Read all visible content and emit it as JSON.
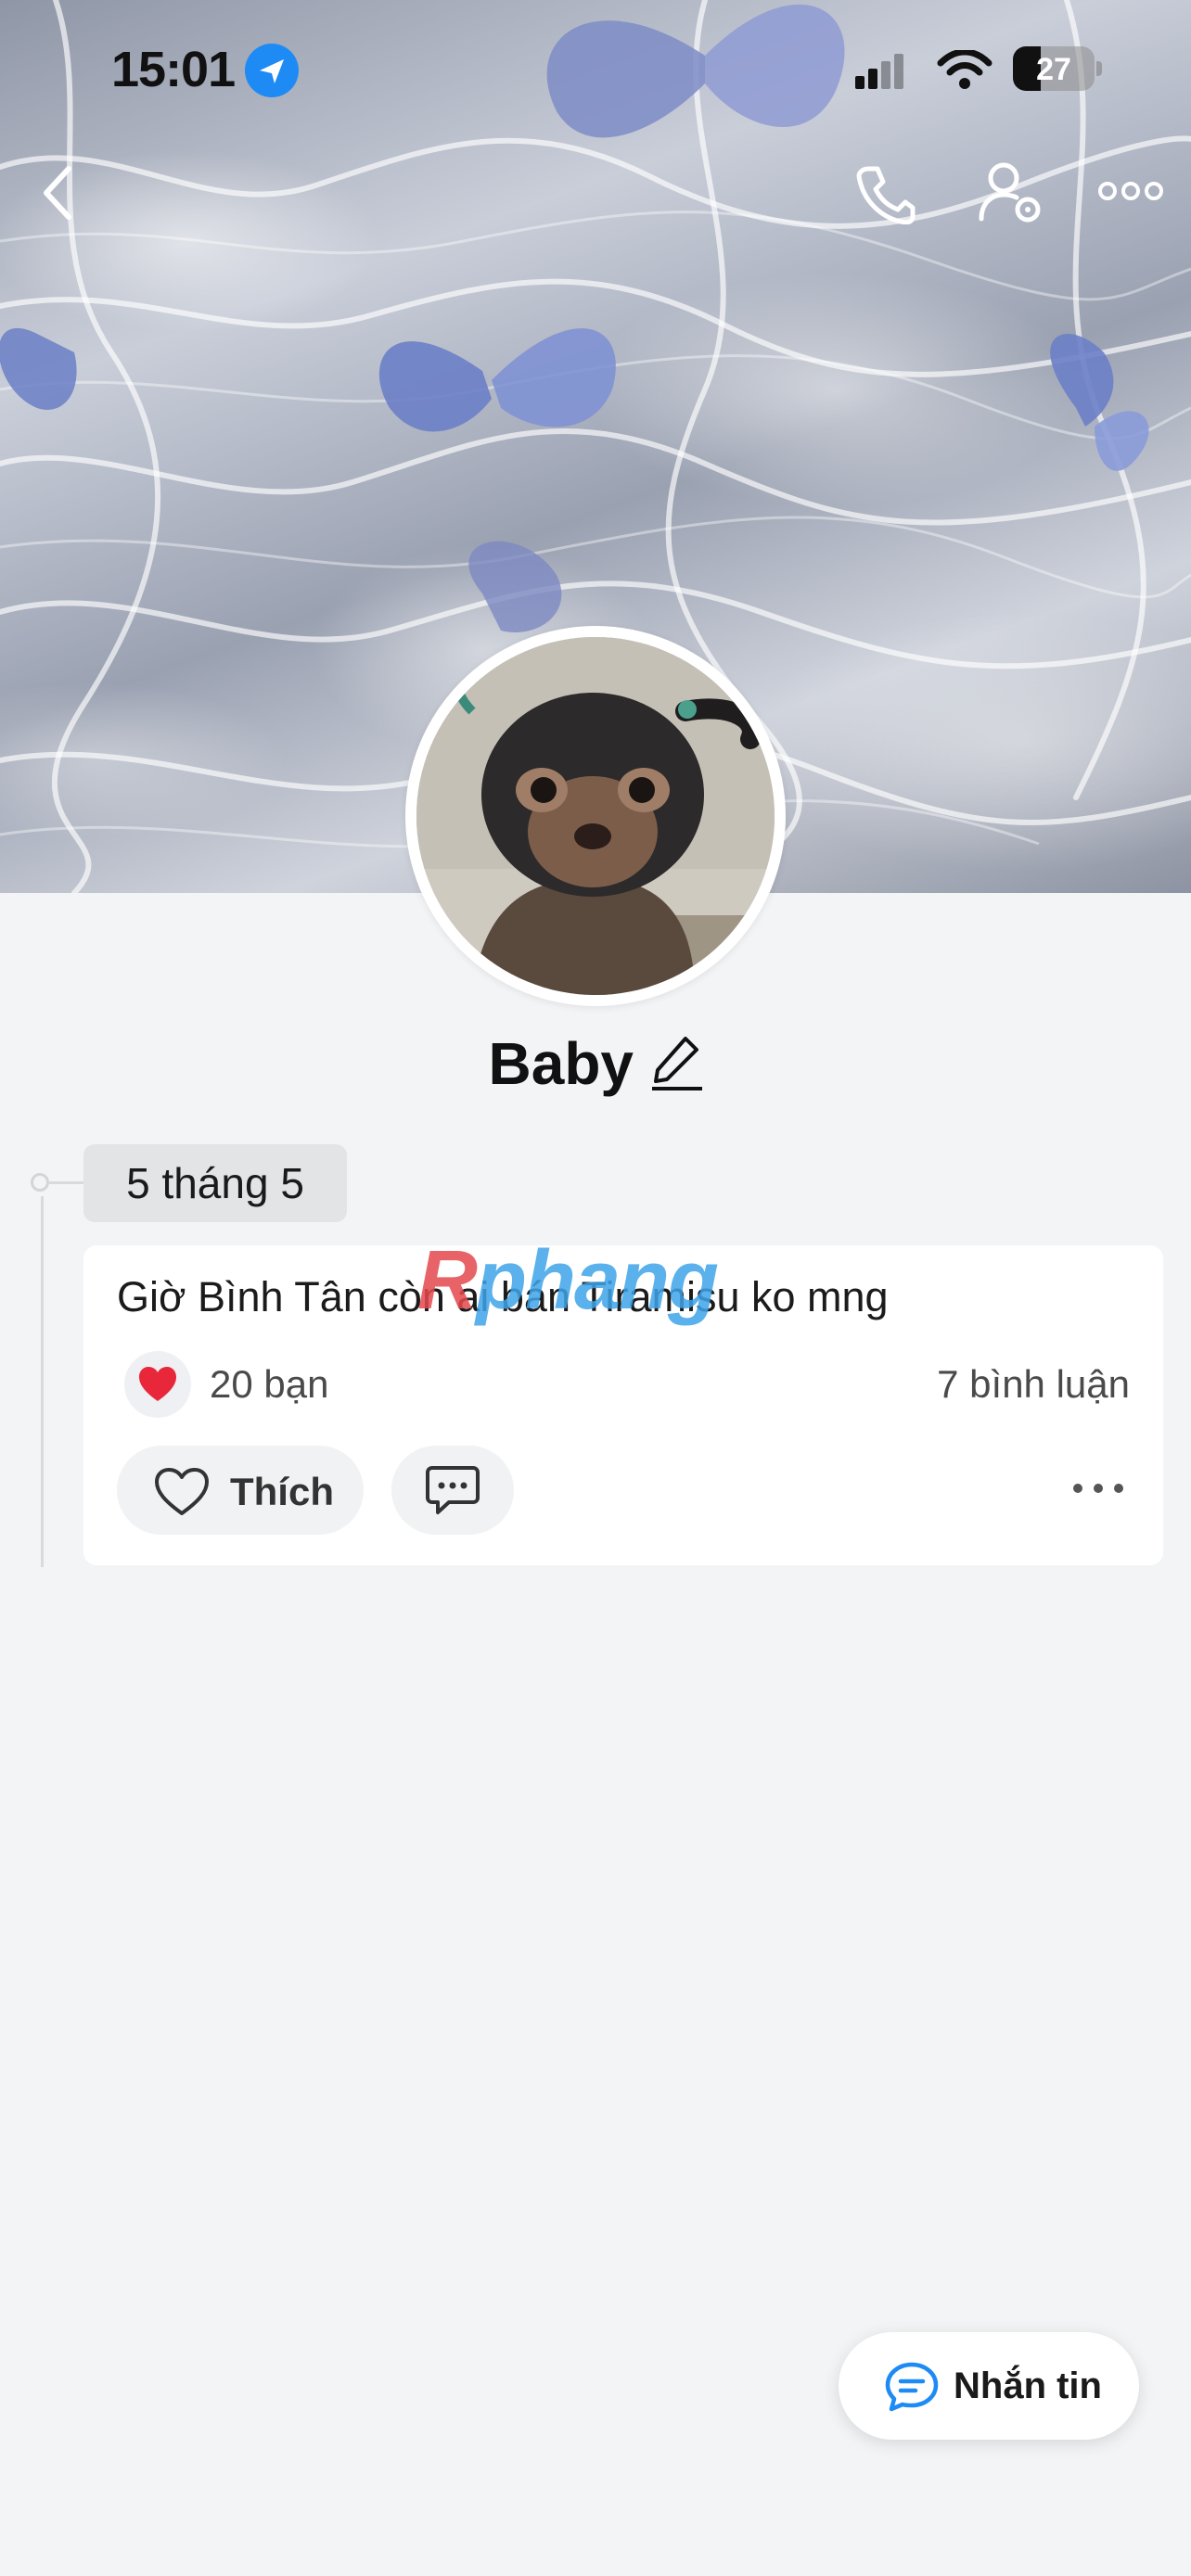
{
  "status_bar": {
    "time": "15:01",
    "battery": "27"
  },
  "profile": {
    "name": "Baby"
  },
  "timeline": {
    "date_label": "5 tháng 5"
  },
  "post": {
    "text": "Giờ Bình Tân còn ai bán Tiramisu ko mng",
    "reactions_label": "20 bạn",
    "comments_label": "7 bình luận",
    "like_label": "Thích"
  },
  "watermark": {
    "text_a": "R",
    "text_b": "phang"
  },
  "message_button": {
    "label": "Nhắn tin"
  },
  "colors": {
    "accent": "#1e8bf5",
    "heart": "#e8283a",
    "background": "#f3f4f6"
  },
  "icons": [
    "back-icon",
    "phone-icon",
    "user-settings-icon",
    "more-icon",
    "edit-pencil-icon",
    "heart-icon",
    "comment-icon",
    "chat-icon",
    "location-arrow-icon",
    "cellular-icon",
    "wifi-icon",
    "battery-icon"
  ]
}
